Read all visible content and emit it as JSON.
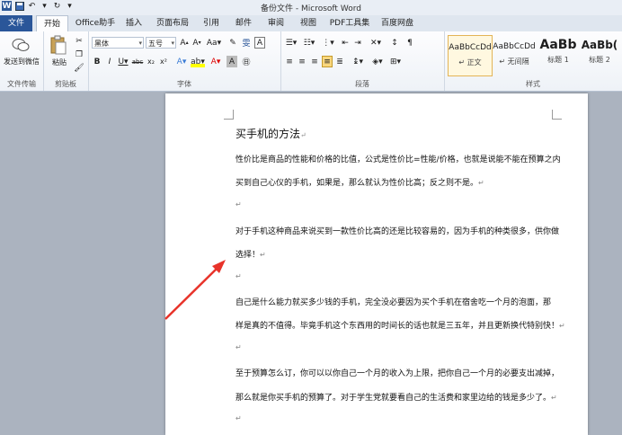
{
  "window": {
    "title": "备份文件 - Microsoft Word"
  },
  "qat": {
    "logo": "W"
  },
  "tabs": [
    "文件",
    "开始",
    "Office助手",
    "插入",
    "页面布局",
    "引用",
    "邮件",
    "审阅",
    "视图",
    "PDF工具集",
    "百度网盘"
  ],
  "ribbon": {
    "send_wechat": "发送到微信",
    "group_file_transfer": "文件传输",
    "paste": "粘贴",
    "group_clipboard": "剪贴板",
    "font_name": "黑体",
    "font_size": "五号",
    "group_font": "字体",
    "group_paragraph": "段落",
    "group_styles": "样式",
    "styles": [
      {
        "preview": "AaBbCcDd",
        "name": "↵ 正文"
      },
      {
        "preview": "AaBbCcDd",
        "name": "↵ 无间隔"
      },
      {
        "preview": "AaBb",
        "name": "标题 1"
      },
      {
        "preview": "AaBb(",
        "name": "标题 2"
      }
    ]
  },
  "document": {
    "title": "买手机的方法",
    "lines": [
      "性价比是商品的性能和价格的比值，公式是性价比=性能/价格，也就是说能不能在预算之内",
      "买到自己心仪的手机，如果是，那么就认为性价比高；反之则不是。",
      "",
      "对于手机这种商品来说买到一款性价比高的还是比较容易的，因为手机的种类很多，供你做",
      "选择！",
      "",
      "自己是什么能力就买多少钱的手机，完全没必要因为买个手机在宿舍吃一个月的泡面，那",
      "样是真的不值得。毕竟手机这个东西用的时间长的话也就是三五年，并且更新换代特别快！",
      "",
      "至于预算怎么订，你可以以你自己一个月的收入为上限，把你自己一个月的必要支出减掉，",
      "那么就是你买手机的预算了。对于学生党就要看自己的生活费和家里边给的钱是多少了。",
      ""
    ],
    "para_mark": "↵"
  },
  "colors": {
    "file_tab": "#2a5699",
    "arrow": "#e8332a",
    "doc_bg": "#abb3bf"
  }
}
